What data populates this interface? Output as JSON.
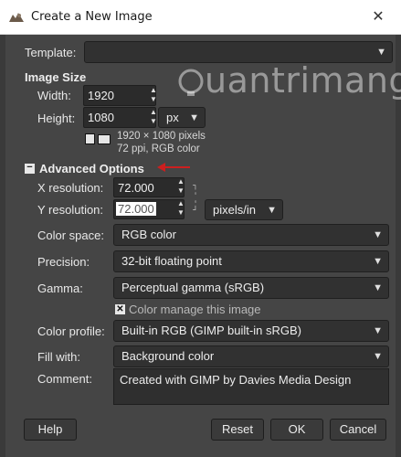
{
  "window": {
    "title": "Create a New Image",
    "close_glyph": "✕"
  },
  "template": {
    "label": "Template:",
    "value": ""
  },
  "image_size": {
    "heading": "Image Size",
    "width_label": "Width:",
    "width_value": "1920",
    "height_label": "Height:",
    "height_value": "1080",
    "unit": "px",
    "info_line1": "1920 × 1080 pixels",
    "info_line2": "72 ppi, RGB color"
  },
  "advanced": {
    "toggle_glyph": "−",
    "heading": "Advanced Options",
    "x_res_label": "X resolution:",
    "x_res_value": "72.000",
    "y_res_label": "Y resolution:",
    "y_res_value": "72.000",
    "res_unit": "pixels/in",
    "color_space_label": "Color space:",
    "color_space_value": "RGB color",
    "precision_label": "Precision:",
    "precision_value": "32-bit floating point",
    "gamma_label": "Gamma:",
    "gamma_value": "Perceptual gamma (sRGB)",
    "manage_label": "Color manage this image",
    "manage_checked": true,
    "profile_label": "Color profile:",
    "profile_value": "Built-in RGB (GIMP built-in sRGB)",
    "fill_label": "Fill with:",
    "fill_value": "Background color",
    "comment_label": "Comment:",
    "comment_value": "Created with GIMP by Davies Media Design"
  },
  "buttons": {
    "help": "Help",
    "reset": "Reset",
    "ok": "OK",
    "cancel": "Cancel"
  },
  "watermark": {
    "text": "uantrimang"
  },
  "colors": {
    "annotation_arrow": "#cc1f1f",
    "dialog_bg": "#454545",
    "field_bg": "#2b2b2b"
  },
  "icons": {
    "app": "gimp-icon",
    "chevron": "chevron-down-icon",
    "spinner": "spinner-arrows-icon",
    "chain": "chain-link-icon",
    "portrait": "portrait-orientation-icon",
    "landscape": "landscape-orientation-icon"
  }
}
